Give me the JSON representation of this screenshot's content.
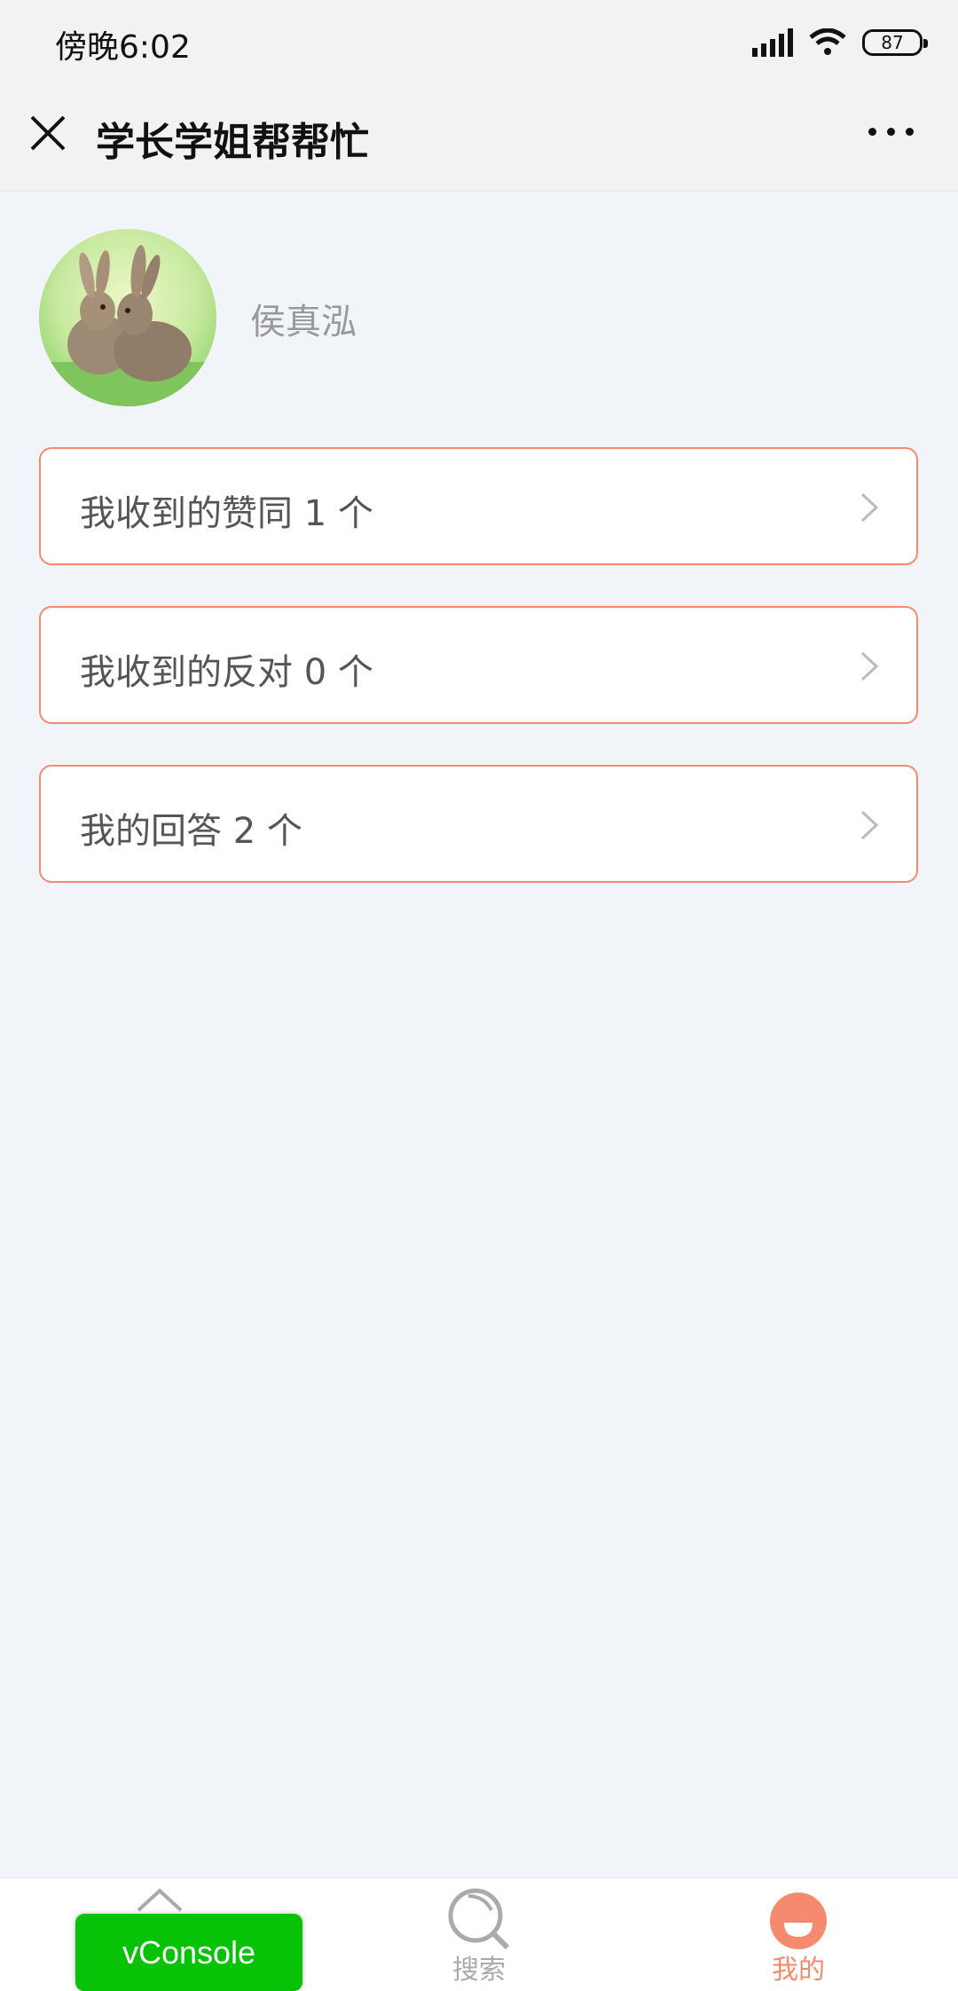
{
  "status_bar": {
    "time": "傍晚6:02",
    "battery": "87"
  },
  "nav": {
    "title": "学长学姐帮帮忙"
  },
  "profile": {
    "name": "侯真泓"
  },
  "cards": [
    {
      "label": "我收到的赞同 1 个"
    },
    {
      "label": "我收到的反对 0 个"
    },
    {
      "label": "我的回答 2 个"
    }
  ],
  "tab_bar": {
    "tabs": [
      {
        "label": "",
        "icon": "home-icon"
      },
      {
        "label": "搜索",
        "icon": "search-icon"
      },
      {
        "label": "我的",
        "icon": "profile-icon"
      }
    ],
    "active_color": "#f58a6e",
    "inactive_color": "#aaaaaa"
  },
  "vconsole": {
    "label": "vConsole",
    "color": "#07c207"
  }
}
